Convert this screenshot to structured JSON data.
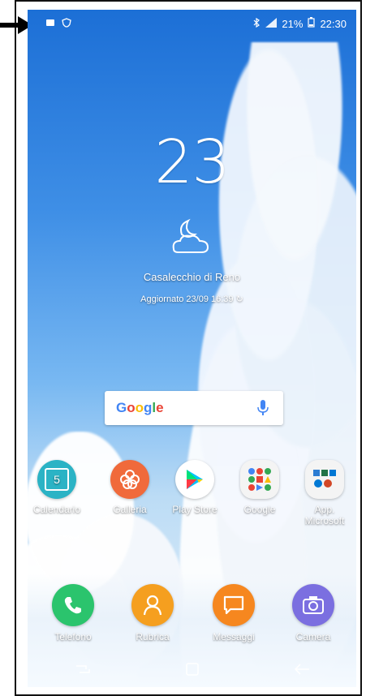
{
  "status": {
    "battery": "21%",
    "time": "22:30"
  },
  "home": {
    "clock": "23",
    "city": "Casalecchio di Reno",
    "updated": "Aggiornato 23/09 16:39"
  },
  "search": {
    "logo": "Google"
  },
  "apps": [
    {
      "label": "Calendario",
      "day": "5"
    },
    {
      "label": "Galleria"
    },
    {
      "label": "Play Store"
    },
    {
      "label": "Google"
    },
    {
      "label": "App. Microsoft"
    }
  ],
  "dock": [
    {
      "label": "Telefono"
    },
    {
      "label": "Rubrica"
    },
    {
      "label": "Messaggi"
    },
    {
      "label": "Camera"
    }
  ],
  "colors": {
    "calendar": "#2bb3c5",
    "gallery": "#f06a3b",
    "phone": "#2bc46d",
    "contacts": "#f59f1f",
    "messages": "#f6871f",
    "camera": "#7b6fe0"
  }
}
